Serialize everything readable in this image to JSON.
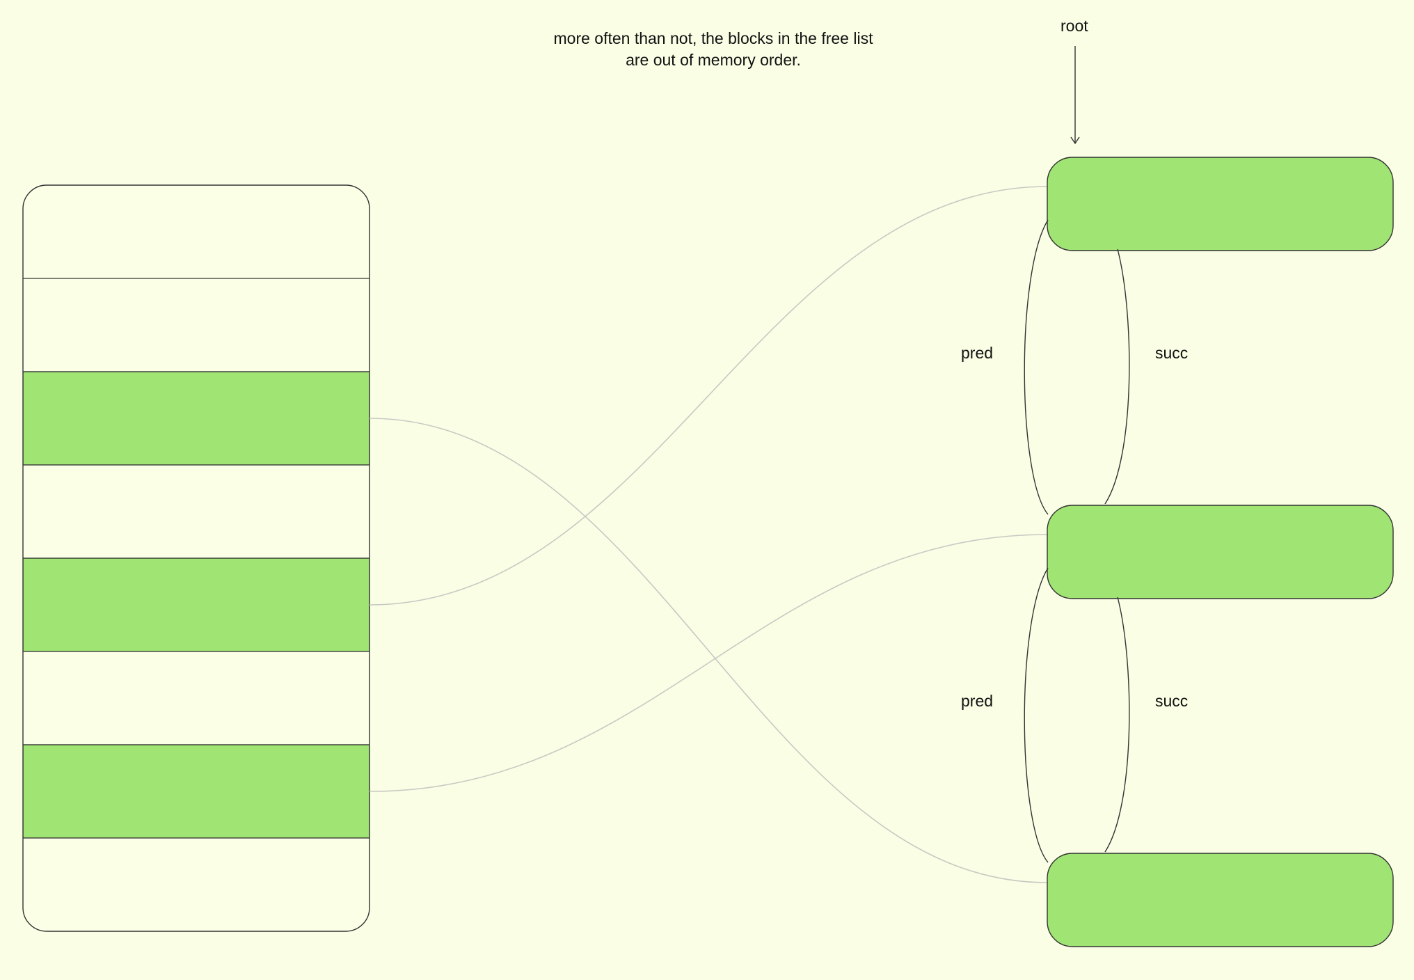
{
  "caption": {
    "line1": "more often than not, the blocks in the free list",
    "line2": "are out of memory order."
  },
  "root_label": "root",
  "links": [
    {
      "pred_label": "pred",
      "succ_label": "succ"
    },
    {
      "pred_label": "pred",
      "succ_label": "succ"
    }
  ],
  "memory": {
    "slot_count": 8,
    "free_slots": [
      2,
      4,
      6
    ]
  },
  "free_list": {
    "node_count": 3,
    "mapping": [
      {
        "slot": 4,
        "node": 0
      },
      {
        "slot": 6,
        "node": 1
      },
      {
        "slot": 2,
        "node": 2
      }
    ]
  },
  "colors": {
    "background": "#fafee5",
    "free_block": "#a0e474",
    "memory_background": "#fbffe6",
    "stroke": "#333333",
    "connector": "#c9c9c3"
  }
}
